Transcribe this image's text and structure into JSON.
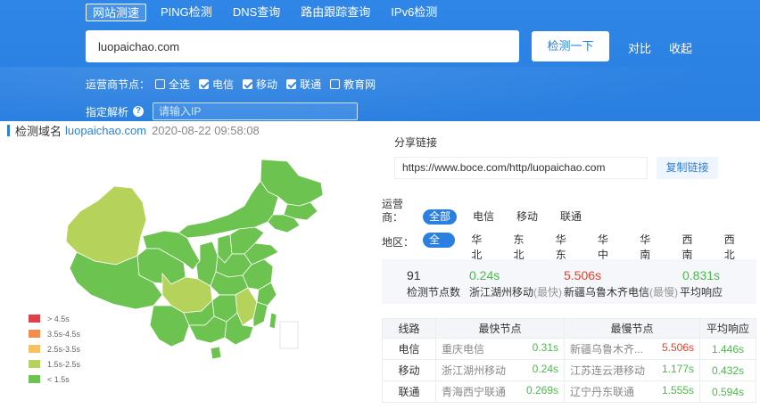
{
  "nav": {
    "tabs": [
      "网站测速",
      "PING检测",
      "DNS查询",
      "路由跟踪查询",
      "IPv6检测"
    ]
  },
  "search": {
    "value": "luopaichao.com",
    "check_button": "检测一下",
    "compare": "对比",
    "collapse": "收起"
  },
  "isp_filter": {
    "label": "运营商节点：",
    "options": [
      {
        "label": "全选",
        "checked": false
      },
      {
        "label": "电信",
        "checked": true
      },
      {
        "label": "移动",
        "checked": true
      },
      {
        "label": "联通",
        "checked": true
      },
      {
        "label": "教育网",
        "checked": false
      }
    ]
  },
  "resolve": {
    "label": "指定解析",
    "help_icon": "?",
    "placeholder": "请输入IP"
  },
  "result": {
    "title": "检测域名",
    "domain": "luopaichao.com",
    "time": "2020-08-22 09:58:08"
  },
  "legend": [
    {
      "label": "> 4.5s",
      "color": "#e0404a"
    },
    {
      "label": "3.5s-4.5s",
      "color": "#f48d4a"
    },
    {
      "label": "2.5s-3.5s",
      "color": "#f7c063"
    },
    {
      "label": "1.5s-2.5s",
      "color": "#b5d25a"
    },
    {
      "label": "< 1.5s",
      "color": "#6cc34f"
    }
  ],
  "share": {
    "title": "分享链接",
    "url": "https://www.boce.com/http/luopaichao.com",
    "copy_button": "复制链接"
  },
  "operator_filter": {
    "label_line1": "运营",
    "label_line2": "商：",
    "pills": [
      "全部",
      "电信",
      "移动",
      "联通"
    ]
  },
  "area_filter": {
    "label": "地区：",
    "pills": [
      "全部",
      "华北",
      "东北",
      "华东",
      "华中",
      "华南",
      "西南",
      "西北"
    ]
  },
  "stats": {
    "nodes": {
      "value": "91",
      "label": "检测节点数"
    },
    "fastest": {
      "value": "0.24s",
      "label": "浙江湖州移动",
      "tag": "(最快)"
    },
    "slowest": {
      "value": "5.506s",
      "label": "新疆乌鲁木齐电信",
      "tag": "(最慢)"
    },
    "avg": {
      "value": "0.831s",
      "label": "平均响应"
    }
  },
  "table": {
    "headers": [
      "线路",
      "最快节点",
      "最慢节点",
      "平均响应"
    ],
    "rows": [
      {
        "isp": "电信",
        "fast_node": "重庆电信",
        "fast_val": "0.31s",
        "slow_node": "新疆乌鲁木齐...",
        "slow_val": "5.506s",
        "avg": "1.446s"
      },
      {
        "isp": "移动",
        "fast_node": "浙江湖州移动",
        "fast_val": "0.24s",
        "slow_node": "江苏连云港移动",
        "slow_val": "1.177s",
        "avg": "0.432s"
      },
      {
        "isp": "联通",
        "fast_node": "青海西宁联通",
        "fast_val": "0.269s",
        "slow_node": "辽宁丹东联通",
        "slow_val": "1.555s",
        "avg": "0.594s"
      }
    ]
  }
}
